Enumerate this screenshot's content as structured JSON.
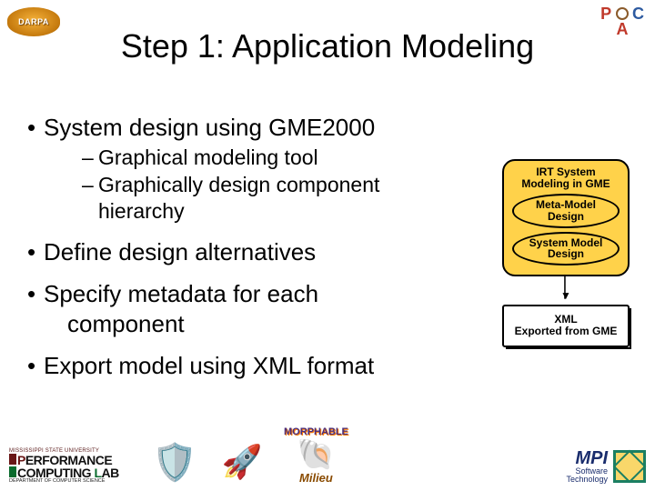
{
  "logos": {
    "darpa_text": "DARPA",
    "pca": {
      "p": "P",
      "c": "C",
      "a": "A"
    },
    "perf_lab": {
      "university": "MISSISSIPPI STATE UNIVERSITY",
      "line1_p": "P",
      "line1_erformance": "ERFORMANCE",
      "line2_c": "C",
      "line2_omputing": "OMPUTING ",
      "line2_l": "L",
      "line2_ab": "AB",
      "dept": "DEPARTMENT OF COMPUTER SCIENCE"
    },
    "morphable_top": "MORPHABLE",
    "morphable_bot": "Milieu",
    "mpi_big": "MPI",
    "mpi_small1": "Software",
    "mpi_small2": "Technology"
  },
  "title": "Step 1: Application Modeling",
  "bullets": {
    "b1": "System design using GME2000",
    "b1_sub1_a": "Graphical modeling tool",
    "b1_sub2_a": "Graphically design component",
    "b1_sub2_b": "hierarchy",
    "b2": "Define design alternatives",
    "b3_a": "Specify metadata for each",
    "b3_b": "component",
    "b4": "Export model using XML format"
  },
  "diagram": {
    "header_a": "IRT System",
    "header_b": "Modeling in GME",
    "oval1_a": "Meta-Model",
    "oval1_b": "Design",
    "oval2_a": "System Model",
    "oval2_b": "Design",
    "box2_a": "XML",
    "box2_b": "Exported from GME"
  }
}
